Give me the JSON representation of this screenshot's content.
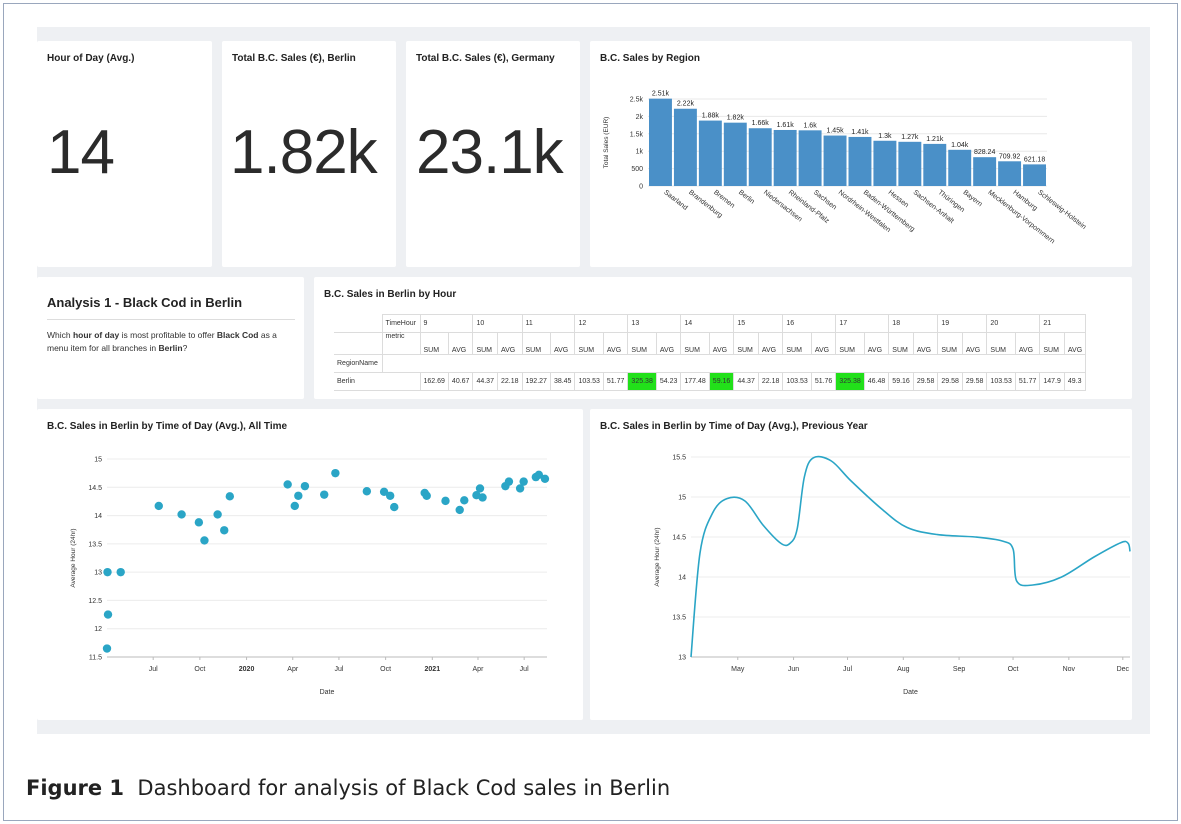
{
  "kpis": [
    {
      "title": "Hour of Day (Avg.)",
      "value": "14"
    },
    {
      "title": "Total B.C. Sales (€), Berlin",
      "value": "1.82k"
    },
    {
      "title": "Total B.C. Sales (€), Germany",
      "value": "23.1k"
    }
  ],
  "markdown": {
    "title": "Analysis 1 - Black Cod in Berlin",
    "text_1": "Which ",
    "bold_1": "hour of day",
    "text_2": " is most profitable to offer ",
    "bold_2": "Black Cod",
    "text_3": " as a menu item for all branches in ",
    "bold_3": "Berlin",
    "text_4": "?"
  },
  "pivot": {
    "title": "B.C. Sales in Berlin by Hour",
    "hour_header": "TimeHour",
    "metric_header": "metric",
    "row_header": "RegionName",
    "row_label": "Berlin",
    "hours": [
      "9",
      "10",
      "11",
      "12",
      "13",
      "14",
      "15",
      "16",
      "17",
      "18",
      "19",
      "20",
      "21"
    ],
    "metrics": [
      "SUM",
      "AVG"
    ],
    "values": [
      "162.69",
      "40.67",
      "44.37",
      "22.18",
      "192.27",
      "38.45",
      "103.53",
      "51.77",
      "325.38",
      "54.23",
      "177.48",
      "59.16",
      "44.37",
      "22.18",
      "103.53",
      "51.76",
      "325.38",
      "46.48",
      "59.16",
      "29.58",
      "29.58",
      "29.58",
      "103.53",
      "51.77",
      "147.9",
      "49.3"
    ],
    "highlight_color": "#22e01a",
    "highlight_indices": [
      8,
      11,
      16
    ]
  },
  "charts": {
    "bar_title": "B.C. Sales by Region",
    "scatter_title": "B.C. Sales in Berlin by Time of Day (Avg.), All Time",
    "line_title": "B.C. Sales in Berlin by Time of Day (Avg.), Previous Year",
    "accent": "#4a90c8"
  },
  "chart_data": [
    {
      "type": "bar",
      "title": "B.C. Sales by Region",
      "ylabel": "Total Sales (EUR)",
      "ylim": [
        0,
        2500
      ],
      "yticks": [
        0,
        500,
        1000,
        1500,
        2000,
        2500
      ],
      "ytick_labels": [
        "0",
        "500",
        "1k",
        "1.5k",
        "2k",
        "2.5k"
      ],
      "categories": [
        "Saarland",
        "Brandenburg",
        "Bremen",
        "Berlin",
        "Niedersachsen",
        "Rheinland-Pfalz",
        "Sachsen",
        "Nordrhein-Westfalen",
        "Baden-Württemberg",
        "Hessen",
        "Sachsen-Anhalt",
        "Thüringen",
        "Bayern",
        "Mecklenburg-Vorpommern",
        "Hamburg",
        "Schleswig-Holstein"
      ],
      "values": [
        2510,
        2220,
        1880,
        1820,
        1660,
        1610,
        1600,
        1450,
        1410,
        1300,
        1270,
        1210,
        1040,
        828.24,
        709.92,
        621.18
      ],
      "data_labels": [
        "2.51k",
        "2.22k",
        "1.88k",
        "1.82k",
        "1.66k",
        "1.61k",
        "1.6k",
        "1.45k",
        "1.41k",
        "1.3k",
        "1.27k",
        "1.21k",
        "1.04k",
        "828.24",
        "709.92",
        "621.18"
      ],
      "color": "#4a90c8"
    },
    {
      "type": "scatter",
      "title": "B.C. Sales in Berlin by Time of Day (Avg.), All Time",
      "xlabel": "Date",
      "ylabel": "Average Hour (24hr)",
      "ylim": [
        11.5,
        15
      ],
      "yticks": [
        11.5,
        12,
        12.5,
        13,
        13.5,
        14,
        14.5,
        15
      ],
      "xlim": [
        "2019-04-01",
        "2021-08-15"
      ],
      "xticks": [
        {
          "date": "2019-07-01",
          "label": "Jul"
        },
        {
          "date": "2019-10-01",
          "label": "Oct"
        },
        {
          "date": "2020-01-01",
          "label": "2020"
        },
        {
          "date": "2020-04-01",
          "label": "Apr"
        },
        {
          "date": "2020-07-01",
          "label": "Jul"
        },
        {
          "date": "2020-10-01",
          "label": "Oct"
        },
        {
          "date": "2021-01-01",
          "label": "2021"
        },
        {
          "date": "2021-04-01",
          "label": "Apr"
        },
        {
          "date": "2021-07-01",
          "label": "Jul"
        }
      ],
      "points": [
        [
          "2019-04-01",
          11.65
        ],
        [
          "2019-04-03",
          12.25
        ],
        [
          "2019-04-02",
          13.0
        ],
        [
          "2019-04-28",
          13.0
        ],
        [
          "2019-07-12",
          14.17
        ],
        [
          "2019-08-26",
          14.02
        ],
        [
          "2019-09-29",
          13.88
        ],
        [
          "2019-10-10",
          13.56
        ],
        [
          "2019-11-05",
          14.02
        ],
        [
          "2019-11-18",
          13.74
        ],
        [
          "2019-11-29",
          14.34
        ],
        [
          "2020-03-22",
          14.55
        ],
        [
          "2020-04-05",
          14.17
        ],
        [
          "2020-04-12",
          14.35
        ],
        [
          "2020-04-25",
          14.52
        ],
        [
          "2020-06-02",
          14.37
        ],
        [
          "2020-06-24",
          14.75
        ],
        [
          "2020-08-25",
          14.43
        ],
        [
          "2020-09-28",
          14.42
        ],
        [
          "2020-10-10",
          14.35
        ],
        [
          "2020-10-18",
          14.15
        ],
        [
          "2020-12-17",
          14.4
        ],
        [
          "2020-12-21",
          14.35
        ],
        [
          "2021-01-27",
          14.26
        ],
        [
          "2021-02-24",
          14.1
        ],
        [
          "2021-03-05",
          14.27
        ],
        [
          "2021-03-29",
          14.36
        ],
        [
          "2021-04-05",
          14.48
        ],
        [
          "2021-04-10",
          14.32
        ],
        [
          "2021-05-25",
          14.52
        ],
        [
          "2021-06-01",
          14.6
        ],
        [
          "2021-06-23",
          14.48
        ],
        [
          "2021-06-30",
          14.6
        ],
        [
          "2021-07-24",
          14.68
        ],
        [
          "2021-07-30",
          14.72
        ],
        [
          "2021-08-11",
          14.65
        ]
      ],
      "color": "#2aa5c6"
    },
    {
      "type": "line",
      "title": "B.C. Sales in Berlin by Time of Day (Avg.), Previous Year",
      "xlabel": "Date",
      "ylabel": "Average Hour (24hr)",
      "ylim": [
        13,
        15.5
      ],
      "yticks": [
        13,
        13.5,
        14,
        14.5,
        15,
        15.5
      ],
      "xlim": [
        "2020-04-05",
        "2020-12-05"
      ],
      "xticks": [
        {
          "date": "2020-05-01",
          "label": "May"
        },
        {
          "date": "2020-06-01",
          "label": "Jun"
        },
        {
          "date": "2020-07-01",
          "label": "Jul"
        },
        {
          "date": "2020-08-01",
          "label": "Aug"
        },
        {
          "date": "2020-09-01",
          "label": "Sep"
        },
        {
          "date": "2020-10-01",
          "label": "Oct"
        },
        {
          "date": "2020-11-01",
          "label": "Nov"
        },
        {
          "date": "2020-12-01",
          "label": "Dec"
        }
      ],
      "points": [
        [
          "2020-04-05",
          13.0
        ],
        [
          "2020-04-10",
          14.3
        ],
        [
          "2020-04-17",
          14.8
        ],
        [
          "2020-04-25",
          14.98
        ],
        [
          "2020-05-05",
          14.95
        ],
        [
          "2020-05-15",
          14.65
        ],
        [
          "2020-05-25",
          14.42
        ],
        [
          "2020-05-30",
          14.42
        ],
        [
          "2020-06-03",
          14.6
        ],
        [
          "2020-06-07",
          15.25
        ],
        [
          "2020-06-12",
          15.49
        ],
        [
          "2020-06-22",
          15.45
        ],
        [
          "2020-07-03",
          15.2
        ],
        [
          "2020-07-20",
          14.85
        ],
        [
          "2020-08-03",
          14.62
        ],
        [
          "2020-08-20",
          14.53
        ],
        [
          "2020-09-10",
          14.5
        ],
        [
          "2020-09-25",
          14.45
        ],
        [
          "2020-10-01",
          14.35
        ],
        [
          "2020-10-03",
          13.95
        ],
        [
          "2020-10-12",
          13.9
        ],
        [
          "2020-10-28",
          14.0
        ],
        [
          "2020-11-15",
          14.25
        ],
        [
          "2020-11-30",
          14.43
        ],
        [
          "2020-12-04",
          14.42
        ],
        [
          "2020-12-05",
          14.32
        ]
      ],
      "color": "#2aa5c6"
    }
  ],
  "caption": {
    "label": "Figure 1",
    "text": "Dashboard for analysis of Black Cod sales in Berlin"
  }
}
